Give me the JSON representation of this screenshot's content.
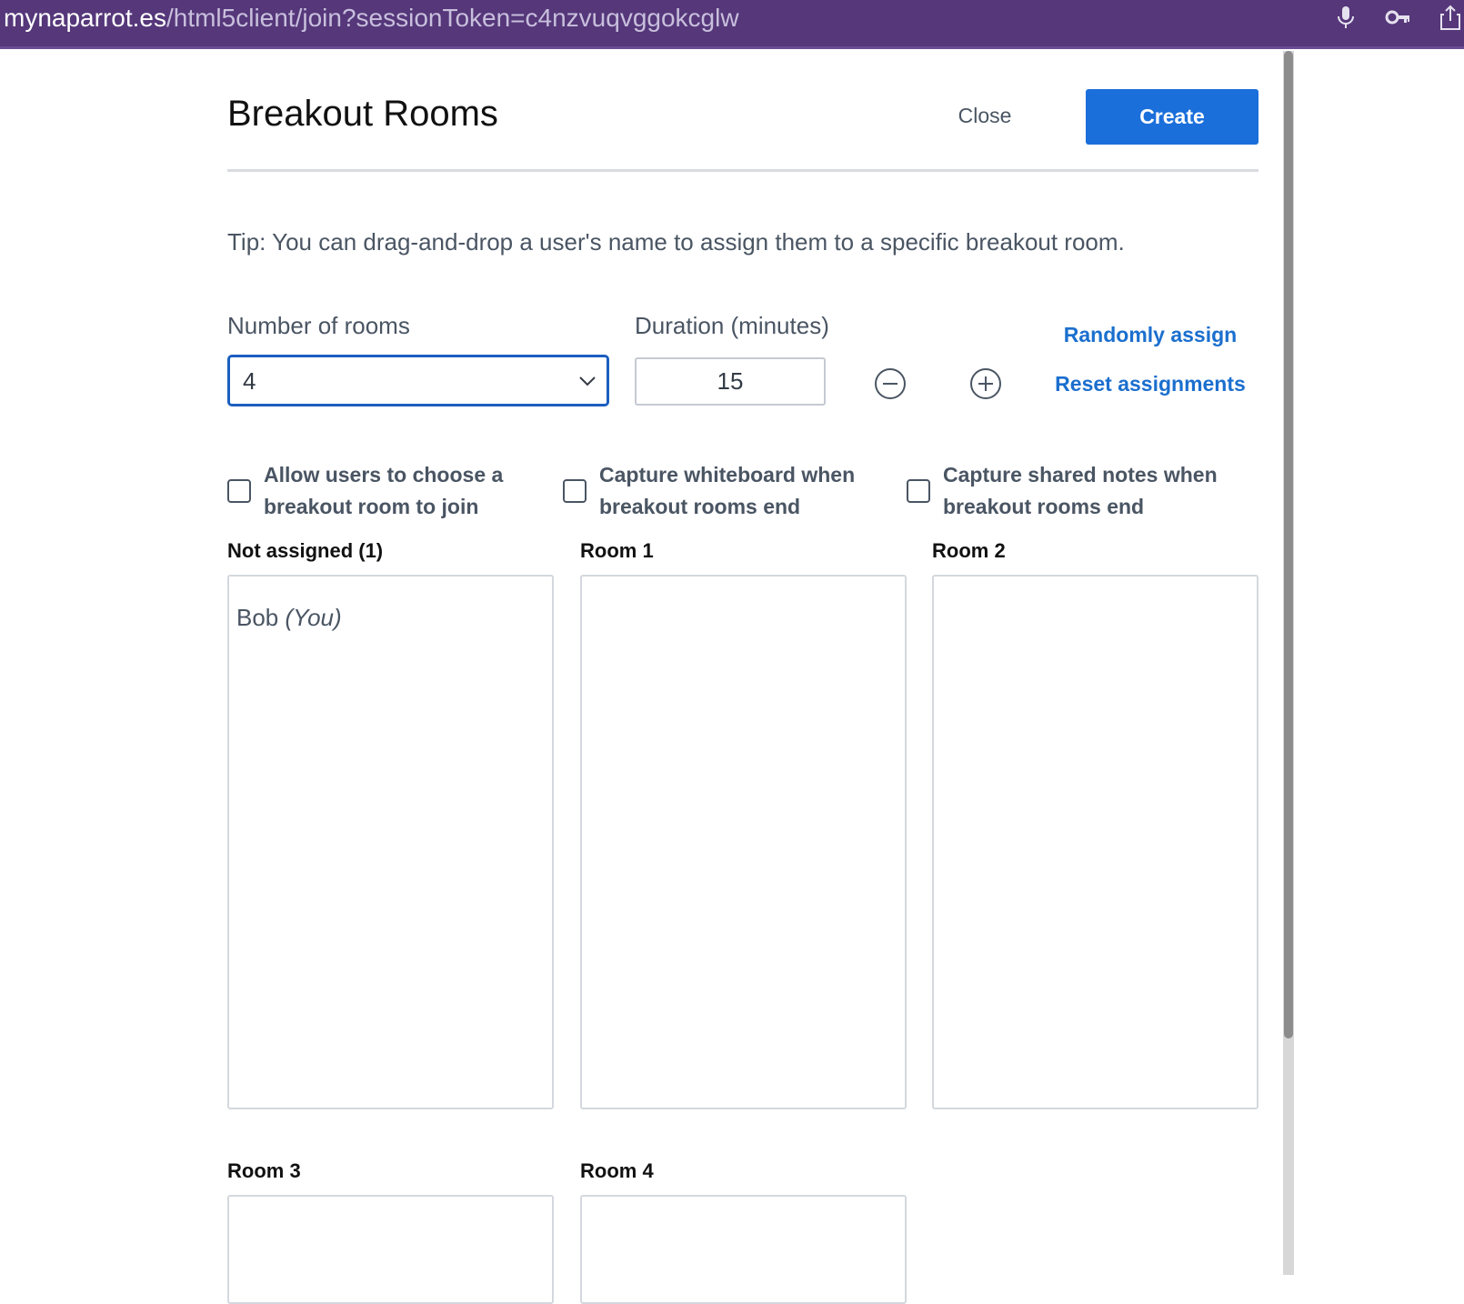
{
  "browser": {
    "url_domain": "mynaparrot.es",
    "url_path": "/html5client/join?sessionToken=c4nzvuqvggokcglw",
    "icons": [
      "microphone-icon",
      "key-icon",
      "share-icon"
    ]
  },
  "modal": {
    "title": "Breakout Rooms",
    "close_label": "Close",
    "create_label": "Create",
    "tip": "Tip: You can drag-and-drop a user's name to assign them to a specific breakout room."
  },
  "controls": {
    "rooms_label": "Number of rooms",
    "rooms_value": "4",
    "duration_label": "Duration (minutes)",
    "duration_value": "15",
    "random_assign_label": "Randomly assign",
    "reset_assign_label": "Reset assignments"
  },
  "options": [
    {
      "label": "Allow users to choose a breakout room to join",
      "checked": false
    },
    {
      "label": "Capture whiteboard when breakout rooms end",
      "checked": false
    },
    {
      "label": "Capture shared notes when breakout rooms end",
      "checked": false
    }
  ],
  "rooms": [
    {
      "title": "Not assigned (1)",
      "users": [
        {
          "name": "Bob",
          "suffix": "(You)"
        }
      ]
    },
    {
      "title": "Room 1",
      "users": []
    },
    {
      "title": "Room 2",
      "users": []
    },
    {
      "title": "Room 3",
      "users": []
    },
    {
      "title": "Room 4",
      "users": []
    }
  ],
  "colors": {
    "url_bar": "#55377a",
    "primary": "#1b6fdb",
    "link": "#1b6fce"
  }
}
